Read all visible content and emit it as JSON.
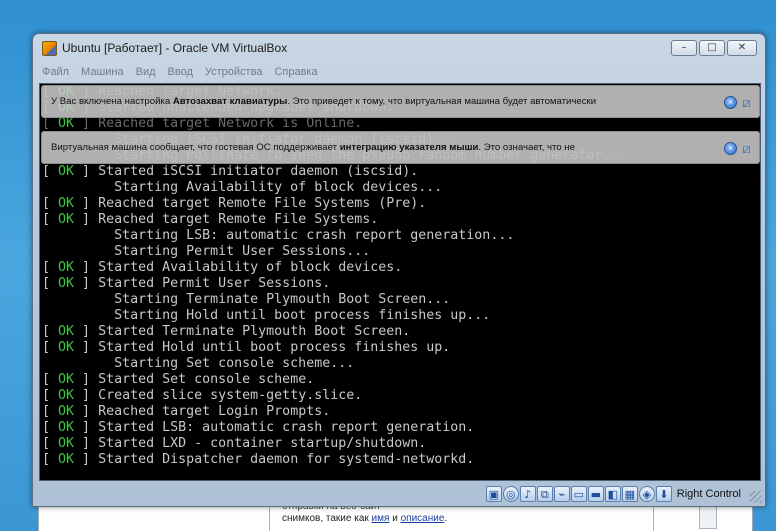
{
  "window": {
    "title": "Ubuntu [Работает] - Oracle VM VirtualBox",
    "controls": {
      "minimize": "–",
      "maximize": "□",
      "close": "✕"
    }
  },
  "menu": [
    "Файл",
    "Машина",
    "Вид",
    "Ввод",
    "Устройства",
    "Справка"
  ],
  "notices": [
    {
      "text_before": "У Вас включена настройка ",
      "bold": "Автозахват клавиатуры",
      "text_after": ". Это приведет к тому, что виртуальная машина будет автоматически",
      "close_icon": "close-icon",
      "mute_icon": "do-not-show-icon"
    },
    {
      "text_before": "Виртуальная машина сообщает, что гостевая ОС поддерживает ",
      "bold": "интеграцию указателя мыши",
      "text_after": ". Это означает, что не",
      "close_icon": "close-icon",
      "mute_icon": "do-not-show-icon"
    }
  ],
  "console_lines": [
    {
      "status": " OK ",
      "text": "Reached target Network."
    },
    {
      "status": " OK ",
      "text": "Started unattended-upgrades shutdown."
    },
    {
      "status": " OK ",
      "text": "Reached target Network is Online."
    },
    {
      "status": "",
      "text": "Starting iSCSI initiator daemon (iscsid)..."
    },
    {
      "status": "",
      "text": "Starting Pollinate to seed the pseudo random number generator..."
    },
    {
      "status": " OK ",
      "text": "Started iSCSI initiator daemon (iscsid)."
    },
    {
      "status": "",
      "text": "Starting Availability of block devices..."
    },
    {
      "status": " OK ",
      "text": "Reached target Remote File Systems (Pre)."
    },
    {
      "status": " OK ",
      "text": "Reached target Remote File Systems."
    },
    {
      "status": "",
      "text": "Starting LSB: automatic crash report generation..."
    },
    {
      "status": "",
      "text": "Starting Permit User Sessions..."
    },
    {
      "status": " OK ",
      "text": "Started Availability of block devices."
    },
    {
      "status": " OK ",
      "text": "Started Permit User Sessions."
    },
    {
      "status": "",
      "text": "Starting Terminate Plymouth Boot Screen..."
    },
    {
      "status": "",
      "text": "Starting Hold until boot process finishes up..."
    },
    {
      "status": " OK ",
      "text": "Started Terminate Plymouth Boot Screen."
    },
    {
      "status": " OK ",
      "text": "Started Hold until boot process finishes up."
    },
    {
      "status": "",
      "text": "Starting Set console scheme..."
    },
    {
      "status": " OK ",
      "text": "Started Set console scheme."
    },
    {
      "status": " OK ",
      "text": "Created slice system-getty.slice."
    },
    {
      "status": " OK ",
      "text": "Reached target Login Prompts."
    },
    {
      "status": " OK ",
      "text": "Started LSB: automatic crash report generation."
    },
    {
      "status": " OK ",
      "text": "Started LXD - container startup/shutdown."
    },
    {
      "status": " OK ",
      "text": "Started Dispatcher daemon for systemd-networkd."
    }
  ],
  "statusbar": {
    "icons": [
      "hard-disk-icon",
      "optical-drive-icon",
      "audio-icon",
      "network-icon",
      "usb-icon",
      "shared-folders-icon",
      "display-icon",
      "video-capture-icon",
      "cpu-icon",
      "mouse-integration-icon",
      "keyboard-capture-icon"
    ],
    "host_key": "Right Control"
  },
  "background_window": {
    "line1": "отправки на веб-сайт",
    "line2_before": "снимков, такие как ",
    "link1": "имя",
    "line2_mid": " и ",
    "link2": "описание",
    "line2_after": "."
  },
  "colors": {
    "ok": "#3ec43e",
    "console_text": "#c8c8c8",
    "console_bg": "#000000",
    "icon_accent": "#2f6fd0"
  }
}
